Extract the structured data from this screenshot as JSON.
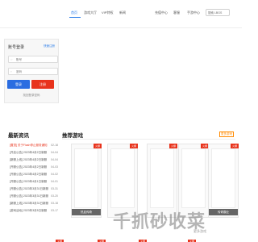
{
  "nav": {
    "items": [
      {
        "label": "首页",
        "active": true
      },
      {
        "label": "游戏大厅",
        "active": false
      },
      {
        "label": "VIP特权",
        "active": false
      },
      {
        "label": "新闻",
        "active": false
      },
      {
        "label": "充值中心",
        "active": false
      },
      {
        "label": "客服",
        "active": false
      },
      {
        "label": "手游中心",
        "active": false
      }
    ],
    "search_value": "搜索 LBGS"
  },
  "login": {
    "title": "账号登录",
    "register_link": "快速注册",
    "account_placeholder": "账号",
    "password_placeholder": "密码",
    "login_button": "登录",
    "register_button": "注册",
    "forgot": "找回登录密码"
  },
  "news": {
    "title": "最新资讯",
    "items": [
      {
        "text": "[置顶] 关于Flash停止服务通知",
        "date": "02-18",
        "hot": true
      },
      {
        "text": "[开启公告] 2023年4月2日新服",
        "date": "04-04",
        "hot": false
      },
      {
        "text": "[新服上线] 2023年4月2日新服",
        "date": "04-04",
        "hot": false
      },
      {
        "text": "[开服公告] 2023年4月2日新服",
        "date": "04-03",
        "hot": false
      },
      {
        "text": "[开服公告] 2023年4月2日新服",
        "date": "04-02",
        "hot": false
      },
      {
        "text": "[开服公告] 2023年4月1日新服",
        "date": "04-01",
        "hot": false
      },
      {
        "text": "[开服公告] 2023年3月31日新服",
        "date": "03-31",
        "hot": false
      },
      {
        "text": "[开服公告] 2023年3月31日新服",
        "date": "03-20",
        "hot": false
      },
      {
        "text": "[新服上线] 2023年3月31日新服",
        "date": "03-18",
        "hot": false
      },
      {
        "text": "[游戏活动] 2023年3月5日新服",
        "date": "03-17",
        "hot": false
      }
    ]
  },
  "games": {
    "title": "推荐游戏",
    "more": "更多游戏",
    "cards": [
      {
        "badge": "火爆",
        "name": "热血传奇"
      },
      {
        "badge": "火爆",
        "name": ""
      },
      {
        "badge": "火爆",
        "name": ""
      },
      {
        "badge": "火爆",
        "name": ""
      },
      {
        "badge": "火爆",
        "name": "传奇霸业"
      }
    ]
  },
  "watermark": {
    "text": "千抓砂收菜",
    "url": "更多游戏"
  }
}
